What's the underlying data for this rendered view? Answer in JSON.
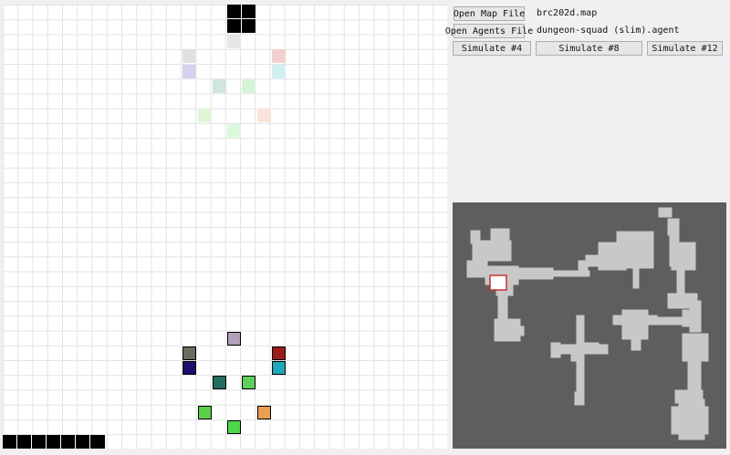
{
  "controls": {
    "open_map_label": "Open Map File",
    "map_file": "brc202d.map",
    "open_agents_label": "Open Agents File",
    "agents_file": "dungeon-squad (slim).agent",
    "simulate_4_label": "Simulate #4",
    "simulate_8_label": "Simulate #8",
    "simulate_12_label": "Simulate #12"
  },
  "colors": {
    "agents": [
      "#b0a0b8",
      "#6b6b60",
      "#9b1c1c",
      "#1a0f6e",
      "#1ca8b8",
      "#1f6e60",
      "#5ccf5c",
      "#5ccf4a",
      "#e8a050",
      "#4cd84c"
    ],
    "ghosts": [
      "#e6e6e8",
      "#e0e0e2",
      "#f0d0d0",
      "#d8d0ec",
      "#d0f0f0",
      "#d0e4e0",
      "#d8f4d8",
      "#e0f4d8",
      "#f8e4d8",
      "#dcf8dc"
    ],
    "minimap_bg": "#5e5e5e",
    "minimap_floor": "#c8c8c8",
    "viewport": "#c83030"
  }
}
